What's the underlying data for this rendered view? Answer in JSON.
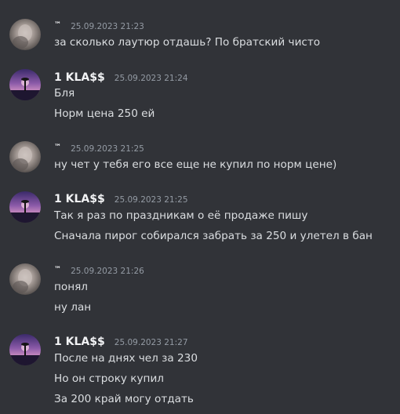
{
  "colors": {
    "background": "#313338",
    "text": "#dbdee1",
    "username": "#f2f3f5",
    "timestamp": "#949ba4"
  },
  "groups": [
    {
      "avatar_icon": "avatar-blurry-photo",
      "username": "™",
      "timestamp": "25.09.2023 21:23",
      "messages": [
        "за сколько лаутюр отдашь? По братский чисто"
      ]
    },
    {
      "avatar_icon": "avatar-purple-sunset",
      "username": "1 KLA$$",
      "timestamp": "25.09.2023 21:24",
      "messages": [
        "Бля",
        "Норм цена 250 ей"
      ]
    },
    {
      "avatar_icon": "avatar-blurry-photo",
      "username": "™",
      "timestamp": "25.09.2023 21:25",
      "messages": [
        "ну чет у тебя его все еще не купил по норм цене)"
      ]
    },
    {
      "avatar_icon": "avatar-purple-sunset",
      "username": "1 KLA$$",
      "timestamp": "25.09.2023 21:25",
      "messages": [
        "Так я раз по праздникам о её продаже пишу",
        "Сначала пирог собирался забрать за 250 и улетел в бан"
      ]
    },
    {
      "avatar_icon": "avatar-blurry-photo",
      "username": "™",
      "timestamp": "25.09.2023 21:26",
      "messages": [
        "понял",
        "ну лан"
      ]
    },
    {
      "avatar_icon": "avatar-purple-sunset",
      "username": "1 KLA$$",
      "timestamp": "25.09.2023 21:27",
      "messages": [
        "После на днях чел за 230",
        "Но он строку купил",
        "За 200 край могу отдать"
      ]
    }
  ]
}
